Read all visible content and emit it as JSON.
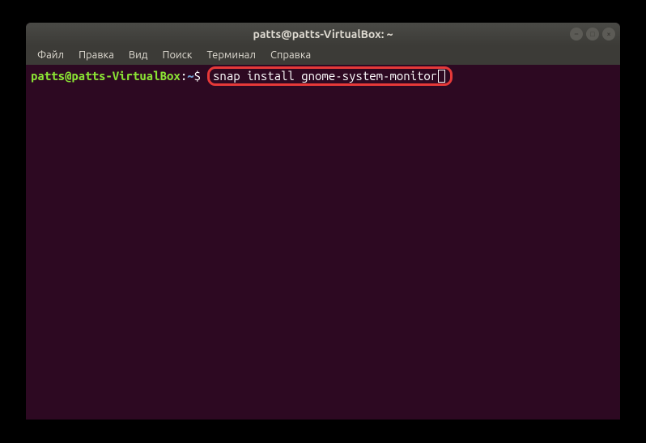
{
  "titlebar": {
    "title": "patts@patts-VirtualBox: ~"
  },
  "window_controls": {
    "minimize": "–",
    "maximize": "□",
    "close": "×"
  },
  "menubar": {
    "file": "Файл",
    "edit": "Правка",
    "view": "Вид",
    "search": "Поиск",
    "terminal": "Терминал",
    "help": "Справка"
  },
  "terminal": {
    "prompt_user": "patts@patts-VirtualBox",
    "prompt_colon": ":",
    "prompt_path": "~",
    "prompt_dollar": "$",
    "command": "snap install gnome-system-monitor"
  }
}
